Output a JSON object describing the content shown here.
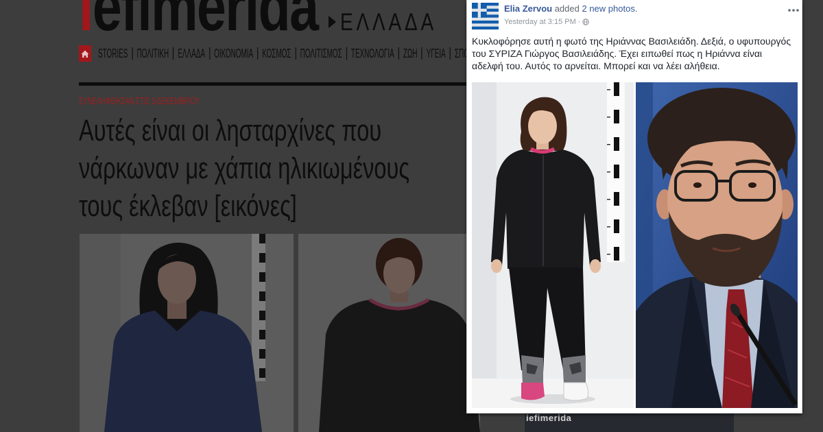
{
  "site": {
    "logo": {
      "accent": "i",
      "rest": "efimerida"
    },
    "section": "ΕΛΛΑΔΑ",
    "home_icon": "home-icon",
    "nav": [
      "STORIES",
      "ΠΟΛΙΤΙΚΗ",
      "ΕΛΛΑΔΑ",
      "ΟΙΚΟΝΟΜΙΑ",
      "ΚΟΣΜΟΣ",
      "ΠΟΛΙΤΙΣΜΟΣ",
      "ΤΕΧΝΟΛΟΓΙΑ",
      "ΖΩΗ",
      "ΥΓΕΙΑ",
      "ΣΠΟΡ"
    ]
  },
  "article": {
    "kicker": "ΣΥΝΕΛΗΦΘΗΣΑΝ ΣΤΙΣ 9 ΔΕΚΕΜΒΡΙΟΥ",
    "headline_lines": [
      "Αυτές είναι οι λησταρχίνες που",
      "νάρκωναν με χάπια ηλικιωμένους",
      "τους έκλεβαν [εικόνες]"
    ]
  },
  "fb_post": {
    "author": "Elia Zervou",
    "action": "added",
    "object": "2 new photos.",
    "timestamp": "Yesterday at 3:15 PM",
    "separator": "·",
    "privacy_icon": "globe-icon",
    "menu_icon": "more-options-icon",
    "text_lines": [
      "Κυκλοφόρησε αυτή η φωτό της Ηριάννας Βασιλειάδη. Δεξιά, ο υφυπουργός",
      "του ΣΥΡΙΖΑ Γιώργος Βασιλειάδης. Έχει ειπωθεί πως η Ηριάννα είναι",
      "αδελφή του. Αυτός το αρνείται. Μπορεί και να λέει αλήθεια."
    ]
  },
  "watermark": "iefimerida",
  "colors": {
    "page_dim": "#3d3d3d",
    "brand_red": "#a3171c",
    "kicker_red": "#9e1f1f",
    "facebook_link": "#365899",
    "facebook_meta": "#90949c",
    "facebook_text": "#1d2129"
  }
}
